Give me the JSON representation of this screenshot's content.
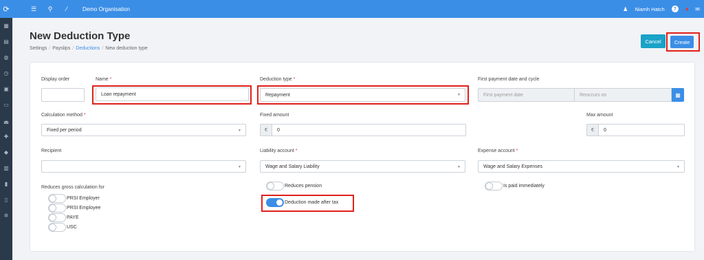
{
  "topbar": {
    "org": "Demo Organisation",
    "user": "Niamh Hatch",
    "help": "?"
  },
  "page": {
    "title": "New Deduction Type",
    "breadcrumb": [
      "Settings",
      "Payslips",
      "Deductions",
      "New deduction type"
    ],
    "cancel_label": "Cancel",
    "create_label": "Create"
  },
  "form": {
    "display_order": {
      "label": "Display order",
      "value": ""
    },
    "name": {
      "label": "Name",
      "value": "Loan repayment"
    },
    "deduction_type": {
      "label": "Deduction type",
      "value": "Repayment"
    },
    "first_payment": {
      "label": "First payment date and cycle",
      "date_placeholder": "First payment date",
      "cycle_placeholder": "Reoccurs on"
    },
    "calculation_method": {
      "label": "Calculation method",
      "value": "Fixed per period"
    },
    "fixed_amount": {
      "label": "Fixed amount",
      "currency": "€",
      "value": "0"
    },
    "max_amount": {
      "label": "Max amount",
      "currency": "€",
      "value": "0"
    },
    "recipient": {
      "label": "Recipient",
      "value": ""
    },
    "liability_account": {
      "label": "Liability account",
      "value": "Wage and Salary Liability"
    },
    "expense_account": {
      "label": "Expense account",
      "value": "Wage and Salary Expenses"
    },
    "reduces_gross": {
      "label": "Reduces gross calculation for",
      "options": [
        {
          "label": "PRSI Employer",
          "on": false
        },
        {
          "label": "PRSI Employee",
          "on": false
        },
        {
          "label": "PAYE",
          "on": false
        },
        {
          "label": "USC",
          "on": false
        }
      ]
    },
    "reduces_pension": {
      "label": "Reduces pension",
      "on": false
    },
    "deduction_after_tax": {
      "label": "Deduction made after tax",
      "on": true
    },
    "is_paid_immediately": {
      "label": "Is paid immediately",
      "on": false
    }
  },
  "colors": {
    "primary": "#3b8ee6",
    "cancel": "#1aa2c8",
    "highlight": "#e0201b",
    "sidebar": "#2b3a4a"
  }
}
